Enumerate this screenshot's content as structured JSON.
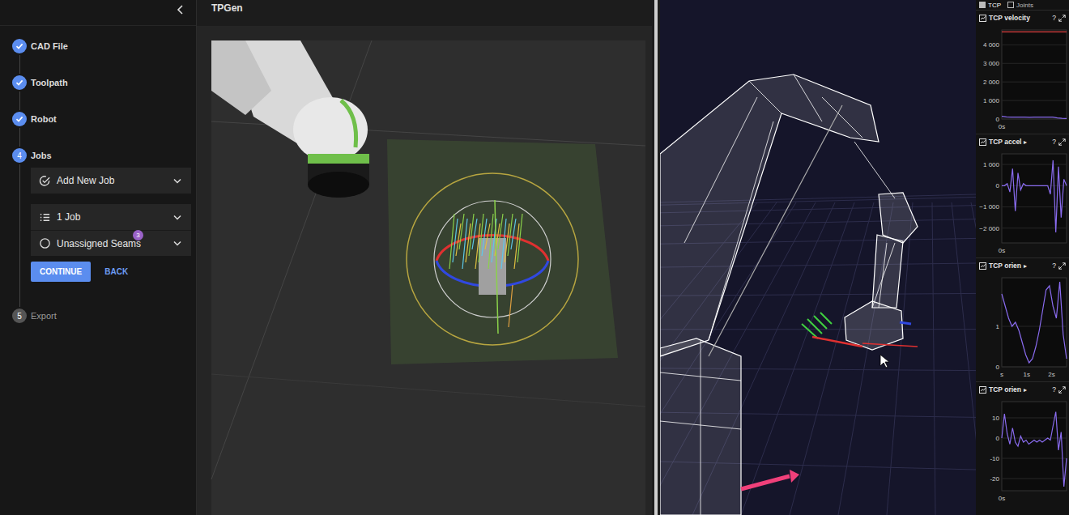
{
  "sidebar": {
    "steps": [
      {
        "number": "",
        "label": "CAD File",
        "done": true,
        "selected": false
      },
      {
        "number": "",
        "label": "Toolpath",
        "done": true,
        "selected": false
      },
      {
        "number": "",
        "label": "Robot",
        "done": true,
        "selected": false
      },
      {
        "number": "4",
        "label": "Jobs",
        "done": false,
        "selected": true
      },
      {
        "number": "5",
        "label": "Export",
        "done": false,
        "selected": false
      }
    ],
    "job_panel": {
      "rows": [
        {
          "label": "Add New Job",
          "kind": "action",
          "badge": ""
        },
        {
          "label": "1 Job",
          "kind": "list",
          "badge": ""
        },
        {
          "label": "Unassigned Seams",
          "kind": "status",
          "badge": "3"
        }
      ],
      "buttons": [
        {
          "label": "CONTINUE",
          "kind": "primary"
        },
        {
          "label": "BACK",
          "kind": "text"
        }
      ]
    }
  },
  "viewport": {
    "title": "TPGen"
  },
  "chart_panel": {
    "tabs": [
      {
        "label": "TCP",
        "selected": true
      },
      {
        "label": "Joints",
        "selected": false
      }
    ],
    "charts": [
      {
        "title": "TCP velocity",
        "expander": "",
        "help": "?",
        "ticks": [
          {
            "label": "4 000",
            "value": 4000
          },
          {
            "label": "3 000",
            "value": 3000
          },
          {
            "label": "2 000",
            "value": 2000
          },
          {
            "label": "1 000",
            "value": 1000
          },
          {
            "label": "0",
            "value": 0
          }
        ],
        "x_ticks": [
          {
            "label": "0s",
            "value": 0
          }
        ],
        "y_min": 0,
        "y_max": 4800,
        "x_max": 2.6,
        "limit": 4700,
        "values": [
          150,
          120,
          100,
          100,
          100,
          100,
          90,
          100,
          100,
          110,
          100,
          100,
          60,
          40,
          30
        ]
      },
      {
        "title": "TCP accel",
        "expander": "▸",
        "help": "?",
        "ticks": [
          {
            "label": "1 000",
            "value": 1000
          },
          {
            "label": "0",
            "value": 0
          },
          {
            "label": "−1 000",
            "value": -1000
          },
          {
            "label": "−2 000",
            "value": -2000
          }
        ],
        "x_ticks": [
          {
            "label": "0s",
            "value": 0
          }
        ],
        "y_min": -2700,
        "y_max": 1500,
        "x_max": 2.6,
        "limit": null,
        "values": [
          0,
          0,
          100,
          -300,
          800,
          -1200,
          600,
          -200,
          100,
          0,
          0,
          0,
          0,
          0,
          0,
          0,
          0,
          0,
          -400,
          1200,
          -2200,
          900,
          -1500,
          300,
          0
        ]
      },
      {
        "title": "TCP orien",
        "expander": "▸",
        "help": "?",
        "ticks": [
          {
            "label": "1",
            "value": 1
          },
          {
            "label": "0",
            "value": 0
          }
        ],
        "x_ticks": [
          {
            "label": "s",
            "value": 0
          },
          {
            "label": "1s",
            "value": 1
          },
          {
            "label": "2s",
            "value": 2
          }
        ],
        "y_min": 0,
        "y_max": 2.2,
        "x_max": 2.6,
        "limit": null,
        "values": [
          1.8,
          1.5,
          1.2,
          1.0,
          1.1,
          0.9,
          0.6,
          0.3,
          0.1,
          0.2,
          0.5,
          0.9,
          1.4,
          1.9,
          2.0,
          1.5,
          1.2,
          2.1,
          0.8,
          0.2
        ]
      },
      {
        "title": "TCP orien",
        "expander": "▸",
        "help": "?",
        "ticks": [
          {
            "label": "10",
            "value": 10
          },
          {
            "label": "0",
            "value": 0
          },
          {
            "label": "-10",
            "value": -10
          },
          {
            "label": "-20",
            "value": -20
          }
        ],
        "x_ticks": [
          {
            "label": "0s",
            "value": 0
          }
        ],
        "y_min": -26,
        "y_max": 18,
        "x_max": 2.6,
        "limit": null,
        "values": [
          0,
          12,
          2,
          -3,
          5,
          -2,
          -4,
          1,
          -2,
          -1,
          -3,
          -2,
          -1,
          -2,
          -1,
          -2,
          -1,
          0,
          -1,
          6,
          13,
          -6,
          3,
          -24,
          -10
        ]
      }
    ]
  }
}
